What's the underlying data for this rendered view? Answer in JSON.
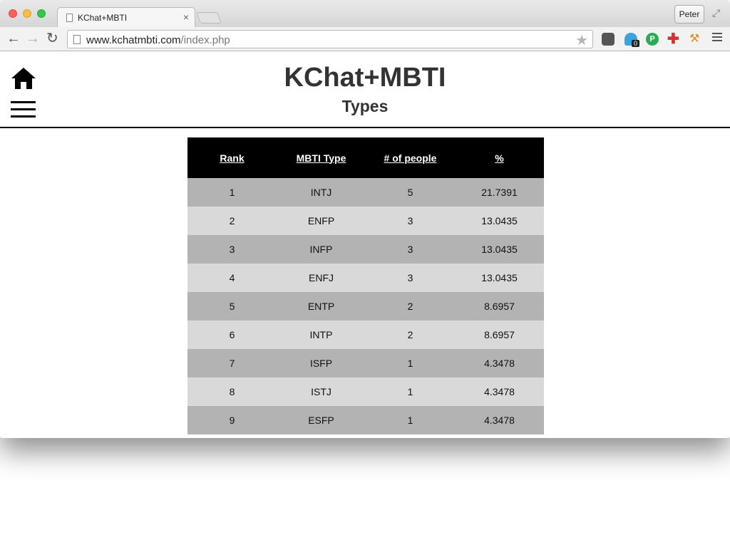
{
  "browser": {
    "tab_title": "KChat+MBTI",
    "tab_close": "×",
    "profile_name": "Peter",
    "url_host": "www.kchatmbti.com",
    "url_path": "/index.php",
    "extension_badge": "0",
    "pushbullet_glyph": "P"
  },
  "header": {
    "site_title": "KChat+MBTI",
    "page_title": "Types"
  },
  "table": {
    "columns": [
      "Rank",
      "MBTI Type",
      "# of people",
      "%"
    ],
    "rows": [
      [
        "1",
        "INTJ",
        "5",
        "21.7391"
      ],
      [
        "2",
        "ENFP",
        "3",
        "13.0435"
      ],
      [
        "3",
        "INFP",
        "3",
        "13.0435"
      ],
      [
        "4",
        "ENFJ",
        "3",
        "13.0435"
      ],
      [
        "5",
        "ENTP",
        "2",
        "8.6957"
      ],
      [
        "6",
        "INTP",
        "2",
        "8.6957"
      ],
      [
        "7",
        "ISFP",
        "1",
        "4.3478"
      ],
      [
        "8",
        "ISTJ",
        "1",
        "4.3478"
      ],
      [
        "9",
        "ESFP",
        "1",
        "4.3478"
      ]
    ]
  },
  "icons": {
    "home": "home-icon",
    "menu": "hamburger-menu-icon"
  }
}
